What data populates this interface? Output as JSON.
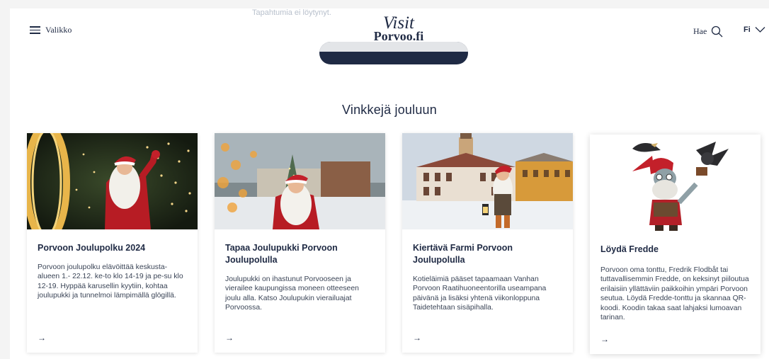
{
  "header": {
    "menu_label": "Valikko",
    "logo_line1": "Visit",
    "logo_line2": "Porvoo.fi",
    "search_label": "Hae",
    "language_label": "Fi"
  },
  "background": {
    "faded_notice": "Tapahtumia ei löytynyt."
  },
  "section": {
    "title": "Vinkkejä jouluun"
  },
  "cards": [
    {
      "title": "Porvoon Joulupolku 2024",
      "text": "Porvoon joulupolku elävöittää keskusta-alueen 1.- 22.12. ke-to klo 14-19 ja pe-su klo 12-19. Hyppää karusellin kyytiin, kohtaa joulupukki ja tunnelmoi lämpimällä glögillä.",
      "arrow": "→"
    },
    {
      "title": "Tapaa Joulupukki Porvoon Joulupolulla",
      "text": "Joulupukki on ihastunut Porvooseen ja vierailee kaupungissa moneen otteeseen joulu alla. Katso Joulupukin vierailuajat Porvoossa.",
      "arrow": "→"
    },
    {
      "title": "Kiertävä Farmi Porvoon Joulupolulla",
      "text": "Kotieläimiä pääset tapaamaan Vanhan Porvoon Raatihuoneentorilla useampana päivänä ja lisäksi yhtenä viikonloppuna Taidetehtaan sisäpihalla.",
      "arrow": "→"
    },
    {
      "title": "Löydä Fredde",
      "text": "Porvoon oma tonttu, Fredrik Flodbåt tai tuttavallisemmin Fredde, on keksinyt piiloutua erilaisiin yllättäviin paikkoihin ympäri Porvoon seutua. Löydä Fredde-tonttu ja skannaa QR-koodi. Koodin takaa saat lahjaksi lumoavan tarinan.",
      "arrow": "→"
    }
  ],
  "colors": {
    "navy": "#1f2a44",
    "santa_red": "#c3202a"
  },
  "icons": {
    "menu": "hamburger-icon",
    "search": "search-icon",
    "language": "chevron-down-icon",
    "card_link": "arrow-right-icon"
  }
}
